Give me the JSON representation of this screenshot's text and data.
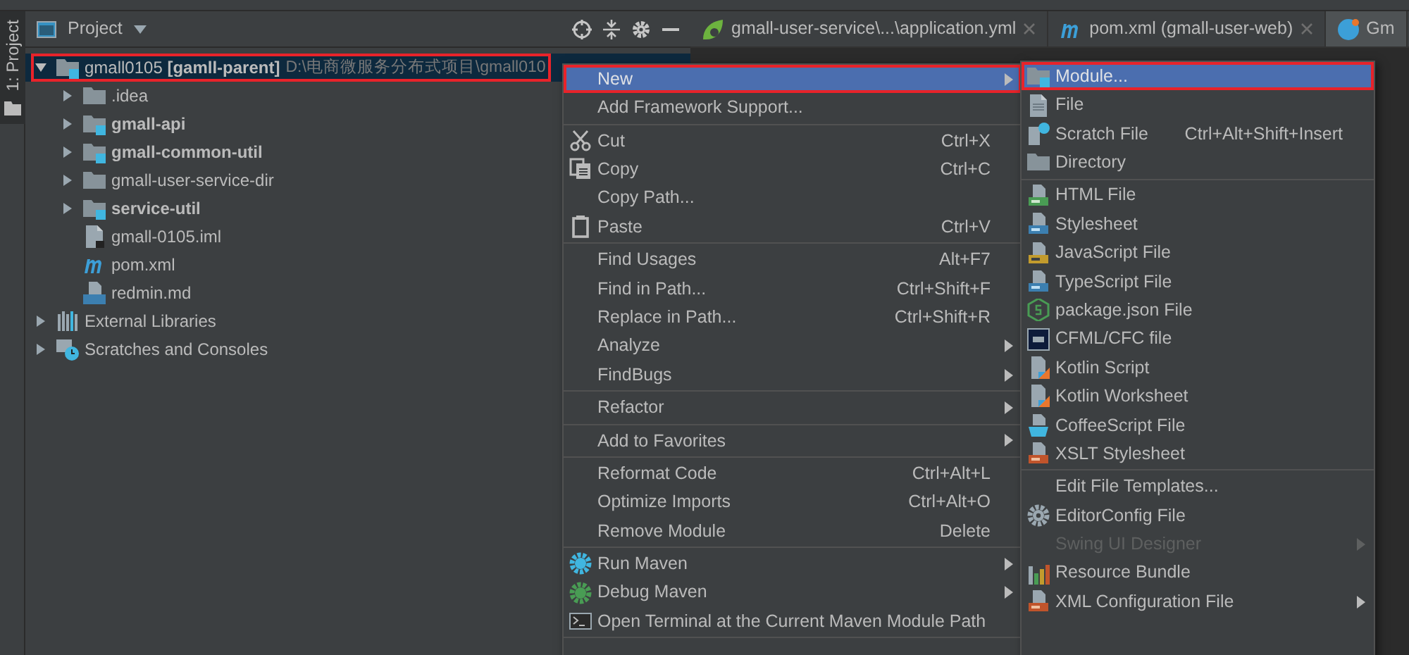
{
  "side_tab": {
    "label": "1: Project"
  },
  "project_panel": {
    "title": "Project"
  },
  "tree": [
    {
      "label": "gmall0105 **[gamll-parent]**",
      "path": "D:\\电商微服务分布式项目\\gmall010",
      "kind": "module",
      "expanded": true,
      "selected": true,
      "annotated": true,
      "children": [
        {
          "label": ".idea",
          "kind": "folder",
          "expanded": false
        },
        {
          "label": "gmall-api",
          "kind": "module",
          "expanded": false
        },
        {
          "label": "gmall-common-util",
          "kind": "module",
          "expanded": false
        },
        {
          "label": "gmall-user-service-dir",
          "kind": "folder",
          "expanded": false
        },
        {
          "label": "service-util",
          "kind": "module",
          "expanded": false
        },
        {
          "label": "gmall-0105.iml",
          "kind": "iml"
        },
        {
          "label": "pom.xml",
          "kind": "maven"
        },
        {
          "label": "redmin.md",
          "kind": "markdown"
        }
      ]
    },
    {
      "label": "External Libraries",
      "kind": "libraries",
      "expanded": false
    },
    {
      "label": "Scratches and Consoles",
      "kind": "scratches",
      "expanded": false
    }
  ],
  "editor_tabs": [
    {
      "label": "gmall-user-service\\...\\application.yml",
      "kind": "spring",
      "selected": false,
      "closable": true
    },
    {
      "label": "pom.xml (gmall-user-web)",
      "kind": "maven",
      "selected": false,
      "closable": true
    },
    {
      "label": "Gm",
      "kind": "class",
      "selected": true,
      "closable": false
    }
  ],
  "context_menu": [
    {
      "label": "New",
      "selected": true,
      "annotated": true,
      "submenu": true
    },
    {
      "label": "Add Framework Support...",
      "separator_after": true
    },
    {
      "label": "Cut",
      "shortcut": "Ctrl+X",
      "kind": "cut"
    },
    {
      "label": "Copy",
      "shortcut": "Ctrl+C",
      "kind": "copy"
    },
    {
      "label": "Copy Path..."
    },
    {
      "label": "Paste",
      "shortcut": "Ctrl+V",
      "kind": "paste",
      "separator_after": true
    },
    {
      "label": "Find Usages",
      "shortcut": "Alt+F7"
    },
    {
      "label": "Find in Path...",
      "shortcut": "Ctrl+Shift+F"
    },
    {
      "label": "Replace in Path...",
      "shortcut": "Ctrl+Shift+R"
    },
    {
      "label": "Analyze",
      "submenu": true
    },
    {
      "label": "FindBugs",
      "submenu": true,
      "separator_after": true
    },
    {
      "label": "Refactor",
      "submenu": true,
      "separator_after": true
    },
    {
      "label": "Add to Favorites",
      "submenu": true,
      "separator_after": true
    },
    {
      "label": "Reformat Code",
      "shortcut": "Ctrl+Alt+L"
    },
    {
      "label": "Optimize Imports",
      "shortcut": "Ctrl+Alt+O"
    },
    {
      "label": "Remove Module",
      "shortcut": "Delete",
      "separator_after": true
    },
    {
      "label": "Run Maven",
      "kind": "maven-run",
      "submenu": true
    },
    {
      "label": "Debug Maven",
      "kind": "maven-debug",
      "submenu": true
    },
    {
      "label": "Open Terminal at the Current Maven Module Path",
      "kind": "terminal",
      "separator_after": true
    }
  ],
  "new_submenu": [
    {
      "label": "Module...",
      "kind": "module",
      "selected": true,
      "annotated": true
    },
    {
      "label": "File",
      "kind": "file"
    },
    {
      "label": "Scratch File",
      "kind": "scratch",
      "shortcut": "Ctrl+Alt+Shift+Insert"
    },
    {
      "label": "Directory",
      "kind": "folder",
      "separator_after": true
    },
    {
      "label": "HTML File",
      "kind": "html"
    },
    {
      "label": "Stylesheet",
      "kind": "css"
    },
    {
      "label": "JavaScript File",
      "kind": "js"
    },
    {
      "label": "TypeScript File",
      "kind": "ts"
    },
    {
      "label": "package.json File",
      "kind": "node"
    },
    {
      "label": "CFML/CFC file",
      "kind": "cf"
    },
    {
      "label": "Kotlin Script",
      "kind": "kotlin"
    },
    {
      "label": "Kotlin Worksheet",
      "kind": "kotlin"
    },
    {
      "label": "CoffeeScript File",
      "kind": "coffee"
    },
    {
      "label": "XSLT Stylesheet",
      "kind": "xslt",
      "separator_after": true
    },
    {
      "label": "Edit File Templates..."
    },
    {
      "label": "EditorConfig File",
      "kind": "gear"
    },
    {
      "label": "Swing UI Designer",
      "disabled": true,
      "submenu": true
    },
    {
      "label": "Resource Bundle",
      "kind": "bundle"
    },
    {
      "label": "XML Configuration File",
      "kind": "xslt",
      "submenu": true
    }
  ]
}
